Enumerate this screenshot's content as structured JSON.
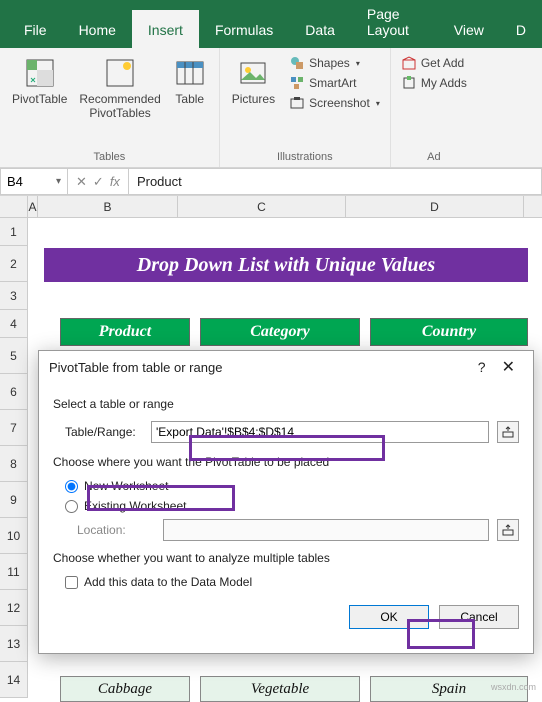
{
  "menubar": {
    "file": "File",
    "home": "Home",
    "insert": "Insert",
    "formulas": "Formulas",
    "data": "Data",
    "page_layout": "Page Layout",
    "view": "View",
    "extra": "D"
  },
  "ribbon": {
    "tables": {
      "pivot": "PivotTable",
      "recommended": "Recommended\nPivotTables",
      "table": "Table",
      "label": "Tables"
    },
    "illustrations": {
      "pictures": "Pictures",
      "shapes": "Shapes",
      "smartart": "SmartArt",
      "screenshot": "Screenshot",
      "label": "Illustrations"
    },
    "addins": {
      "get": "Get Add",
      "my": "My Adds",
      "label": "Ad"
    }
  },
  "namebox": "B4",
  "formula_value": "Product",
  "banner": "Drop Down List with Unique Values",
  "table_headers": {
    "c1": "Product",
    "c2": "Category",
    "c3": "Country"
  },
  "table_row": {
    "c1": "Cabbage",
    "c2": "Vegetable",
    "c3": "Spain"
  },
  "col_labels": {
    "a": "A",
    "b": "B",
    "c": "C",
    "d": "D"
  },
  "row_labels": [
    "1",
    "2",
    "3",
    "4",
    "5",
    "6",
    "7",
    "8",
    "9",
    "10",
    "11",
    "12",
    "13",
    "14"
  ],
  "dialog": {
    "title": "PivotTable from table or range",
    "select_label": "Select a table or range",
    "table_range_label": "Table/Range:",
    "table_range_value": "'Export Data'!$B$4:$D$14",
    "placement_label": "Choose where you want the PivotTable to be placed",
    "new_ws": "New Worksheet",
    "existing_ws": "Existing Worksheet",
    "location_label": "Location:",
    "location_value": "",
    "multi_label": "Choose whether you want to analyze multiple tables",
    "datamodel": "Add this data to the Data Model",
    "ok": "OK",
    "cancel": "Cancel",
    "help": "?",
    "close": "✕"
  },
  "watermark": "wsxdn.com"
}
